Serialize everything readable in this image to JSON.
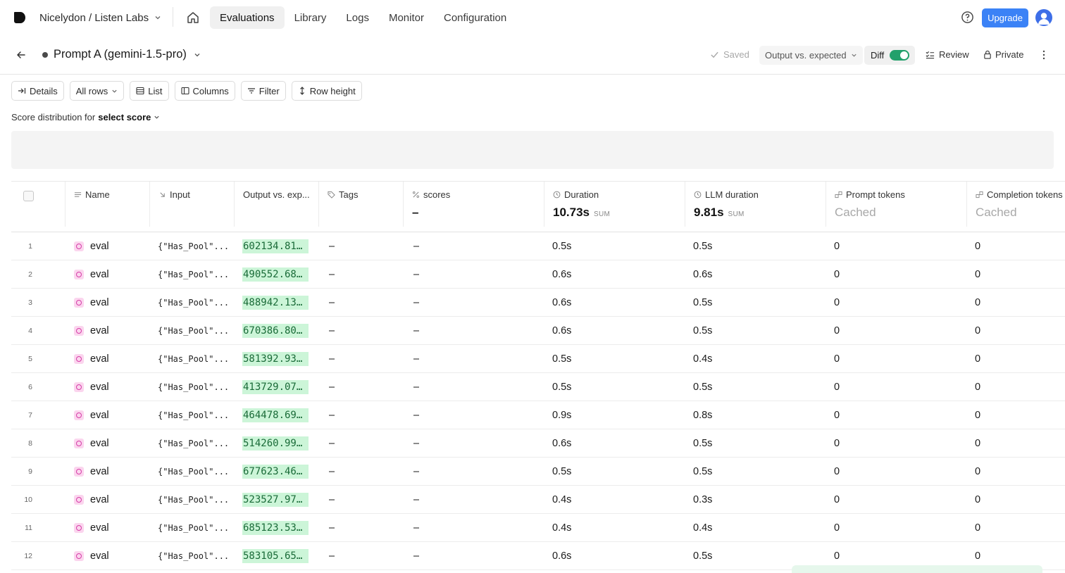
{
  "nav": {
    "org": "Nicelydon / Listen Labs",
    "tabs": [
      "Evaluations",
      "Library",
      "Logs",
      "Monitor",
      "Configuration"
    ],
    "active_tab": "Evaluations",
    "upgrade_label": "Upgrade"
  },
  "experiment": {
    "title": "Prompt A (gemini-1.5-pro)",
    "saved_label": "Saved",
    "compare_label": "Output vs. expected",
    "diff_label": "Diff",
    "diff_on": true,
    "review_label": "Review",
    "private_label": "Private"
  },
  "toolbar": {
    "details": "Details",
    "rows": "All rows",
    "list": "List",
    "columns": "Columns",
    "filter": "Filter",
    "row_height": "Row height"
  },
  "score_distribution": {
    "prefix": "Score distribution for",
    "selector": "select score"
  },
  "table": {
    "columns": {
      "name": "Name",
      "input": "Input",
      "output": "Output vs. exp...",
      "tags": "Tags",
      "scores": "scores",
      "duration": "Duration",
      "llm_duration": "LLM duration",
      "prompt_tokens": "Prompt tokens",
      "completion_tokens": "Completion tokens"
    },
    "aggregates": {
      "scores": "–",
      "duration": "10.73s",
      "duration_unit": "SUM",
      "llm_duration": "9.81s",
      "llm_duration_unit": "SUM",
      "prompt_tokens": "Cached",
      "completion_tokens": "Cached"
    },
    "rows": [
      {
        "n": "1",
        "name": "eval",
        "input": "{\"Has_Pool\"...",
        "output": "602134.81...",
        "tags": "–",
        "scores": "–",
        "duration": "0.5s",
        "llm": "0.5s",
        "pt": "0",
        "ct": "0"
      },
      {
        "n": "2",
        "name": "eval",
        "input": "{\"Has_Pool\"...",
        "output": "490552.68...",
        "tags": "–",
        "scores": "–",
        "duration": "0.6s",
        "llm": "0.6s",
        "pt": "0",
        "ct": "0"
      },
      {
        "n": "3",
        "name": "eval",
        "input": "{\"Has_Pool\"...",
        "output": "488942.13...",
        "tags": "–",
        "scores": "–",
        "duration": "0.6s",
        "llm": "0.5s",
        "pt": "0",
        "ct": "0"
      },
      {
        "n": "4",
        "name": "eval",
        "input": "{\"Has_Pool\"...",
        "output": "670386.80...",
        "tags": "–",
        "scores": "–",
        "duration": "0.6s",
        "llm": "0.5s",
        "pt": "0",
        "ct": "0"
      },
      {
        "n": "5",
        "name": "eval",
        "input": "{\"Has_Pool\"...",
        "output": "581392.93...",
        "tags": "–",
        "scores": "–",
        "duration": "0.5s",
        "llm": "0.4s",
        "pt": "0",
        "ct": "0"
      },
      {
        "n": "6",
        "name": "eval",
        "input": "{\"Has_Pool\"...",
        "output": "413729.07...",
        "tags": "–",
        "scores": "–",
        "duration": "0.5s",
        "llm": "0.5s",
        "pt": "0",
        "ct": "0"
      },
      {
        "n": "7",
        "name": "eval",
        "input": "{\"Has_Pool\"...",
        "output": "464478.69...",
        "tags": "–",
        "scores": "–",
        "duration": "0.9s",
        "llm": "0.8s",
        "pt": "0",
        "ct": "0"
      },
      {
        "n": "8",
        "name": "eval",
        "input": "{\"Has_Pool\"...",
        "output": "514260.99...",
        "tags": "–",
        "scores": "–",
        "duration": "0.6s",
        "llm": "0.5s",
        "pt": "0",
        "ct": "0"
      },
      {
        "n": "9",
        "name": "eval",
        "input": "{\"Has_Pool\"...",
        "output": "677623.46...",
        "tags": "–",
        "scores": "–",
        "duration": "0.5s",
        "llm": "0.5s",
        "pt": "0",
        "ct": "0"
      },
      {
        "n": "10",
        "name": "eval",
        "input": "{\"Has_Pool\"...",
        "output": "523527.97...",
        "tags": "–",
        "scores": "–",
        "duration": "0.4s",
        "llm": "0.3s",
        "pt": "0",
        "ct": "0"
      },
      {
        "n": "11",
        "name": "eval",
        "input": "{\"Has_Pool\"...",
        "output": "685123.53...",
        "tags": "–",
        "scores": "–",
        "duration": "0.4s",
        "llm": "0.4s",
        "pt": "0",
        "ct": "0"
      },
      {
        "n": "12",
        "name": "eval",
        "input": "{\"Has_Pool\"...",
        "output": "583105.65...",
        "tags": "–",
        "scores": "–",
        "duration": "0.6s",
        "llm": "0.5s",
        "pt": "0",
        "ct": "0"
      }
    ]
  },
  "colors": {
    "accent": "#3b82f6",
    "toggle_on": "#22a06b",
    "diff_highlight": "#ccf5d8",
    "eval_icon": "#d63ca8"
  },
  "icons": {
    "logo": "logo-icon",
    "home": "home-icon",
    "help": "help-circle-icon",
    "back": "arrow-left-icon",
    "saved": "check-icon",
    "review": "checklist-icon",
    "private": "lock-icon",
    "more": "kebab-icon"
  }
}
